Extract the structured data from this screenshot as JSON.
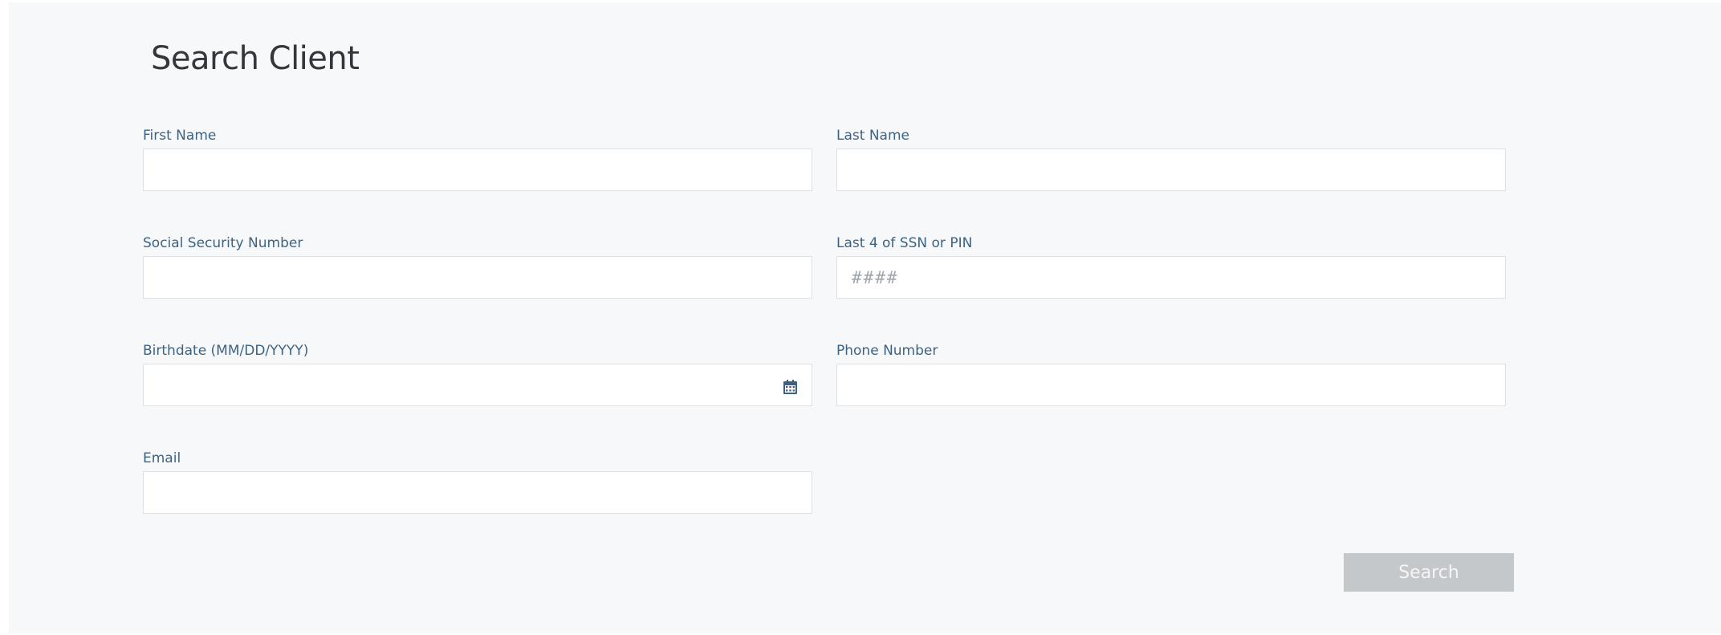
{
  "page": {
    "title": "Search Client"
  },
  "form": {
    "first_name": {
      "label": "First Name",
      "value": "",
      "placeholder": ""
    },
    "last_name": {
      "label": "Last Name",
      "value": "",
      "placeholder": ""
    },
    "ssn": {
      "label": "Social Security Number",
      "value": "",
      "placeholder": ""
    },
    "last4": {
      "label": "Last 4 of SSN or PIN",
      "value": "",
      "placeholder": "####"
    },
    "birthdate": {
      "label": "Birthdate (MM/DD/YYYY)",
      "value": "",
      "placeholder": "",
      "icon": "calendar-icon"
    },
    "phone": {
      "label": "Phone Number",
      "value": "",
      "placeholder": ""
    },
    "email": {
      "label": "Email",
      "value": "",
      "placeholder": ""
    }
  },
  "actions": {
    "search_label": "Search"
  },
  "colors": {
    "panel_bg": "#f6f8fa",
    "label": "#3d6384",
    "title": "#33363a",
    "button_disabled": "#c5c8cb",
    "input_border": "#dde1e5"
  }
}
